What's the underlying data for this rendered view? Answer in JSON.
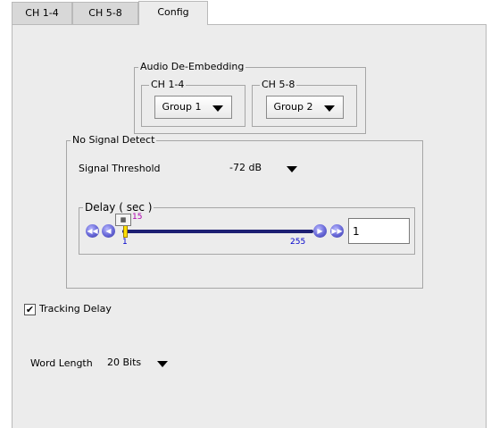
{
  "tabs": [
    {
      "label": "CH 1-4",
      "active": false
    },
    {
      "label": "CH 5-8",
      "active": false
    },
    {
      "label": "Config",
      "active": true
    }
  ],
  "audio_deembedding": {
    "title": "Audio De-Embedding",
    "ch14": {
      "label": "CH 1-4",
      "value": "Group 1"
    },
    "ch58": {
      "label": "CH 5-8",
      "value": "Group 2"
    }
  },
  "no_signal_detect": {
    "title": "No Signal Detect",
    "threshold_label": "Signal Threshold",
    "threshold_value": "-72 dB",
    "delay": {
      "title": "Delay ( sec )",
      "min": "1",
      "max": "255",
      "current": "15",
      "input_value": "1"
    }
  },
  "tracking_delay": {
    "label": "Tracking Delay",
    "checked": true
  },
  "word_length": {
    "label": "Word Length",
    "value": "20 Bits"
  },
  "colors": {
    "accent": "#1d1f73",
    "slider_button": "#6666d6",
    "tick_value": "#b000b0",
    "range_label": "#0000cc",
    "thumb": "#ffe000"
  }
}
